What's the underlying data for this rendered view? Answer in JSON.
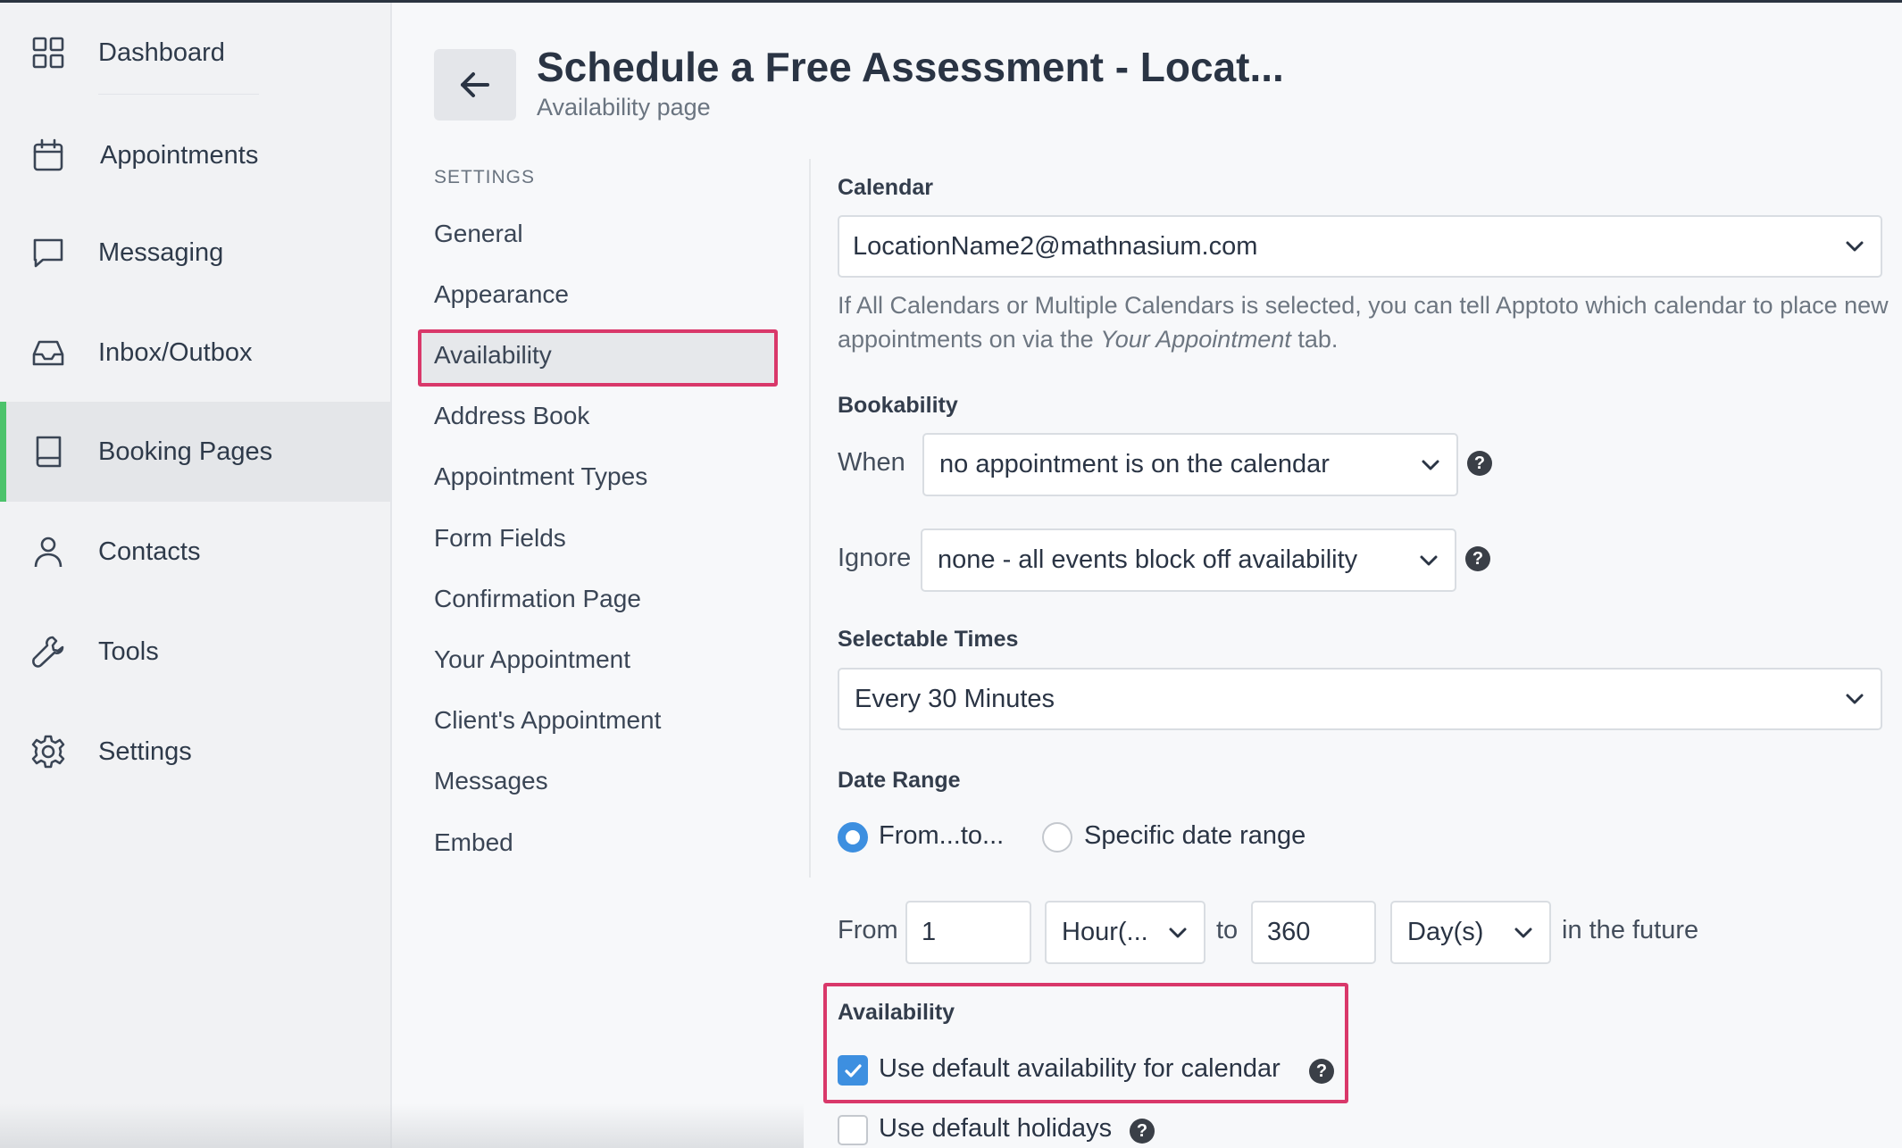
{
  "sidebar": {
    "items": [
      {
        "label": "Dashboard",
        "icon": "grid-icon"
      },
      {
        "label": "Appointments",
        "icon": "calendar-icon"
      },
      {
        "label": "Messaging",
        "icon": "chat-bubble-icon"
      },
      {
        "label": "Inbox/Outbox",
        "icon": "inbox-icon"
      },
      {
        "label": "Booking Pages",
        "icon": "book-icon",
        "active": true
      },
      {
        "label": "Contacts",
        "icon": "user-icon"
      },
      {
        "label": "Tools",
        "icon": "wrench-icon"
      },
      {
        "label": "Settings",
        "icon": "gear-icon"
      }
    ],
    "active_color": "#4cc36b"
  },
  "header": {
    "title": "Schedule a Free Assessment - Locat...",
    "subtitle": "Availability page"
  },
  "settings_nav": {
    "heading": "SETTINGS",
    "items": [
      "General",
      "Appearance",
      "Availability",
      "Address Book",
      "Appointment Types",
      "Form Fields",
      "Confirmation Page",
      "Your Appointment",
      "Client's Appointment",
      "Messages",
      "Embed"
    ],
    "active": "Availability",
    "highlight_color": "#d9386a"
  },
  "form": {
    "calendar": {
      "label": "Calendar",
      "value": "LocationName2@mathnasium.com",
      "help_line1": "If All Calendars or Multiple Calendars is selected, you can tell Apptoto which calendar to place new",
      "help_line2_pre": "appointments on via the ",
      "help_line2_em": "Your Appointment",
      "help_line2_post": " tab."
    },
    "bookability": {
      "label": "Bookability",
      "when_label": "When",
      "when_value": "no appointment is on the calendar",
      "ignore_label": "Ignore",
      "ignore_value": "none - all events block off availability"
    },
    "selectable_times": {
      "label": "Selectable Times",
      "value": "Every 30 Minutes"
    },
    "date_range": {
      "label": "Date Range",
      "option_from_to": "From...to...",
      "option_specific": "Specific date range",
      "selected": "From...to...",
      "from_label": "From",
      "from_value": "1",
      "from_unit": "Hour(...",
      "to_label": "to",
      "to_value": "360",
      "to_unit": "Day(s)",
      "suffix": "in the future"
    },
    "availability": {
      "label": "Availability",
      "use_default_availability": "Use default availability for calendar",
      "use_default_availability_checked": true,
      "use_default_holidays": "Use default holidays",
      "use_default_holidays_checked": false
    }
  },
  "colors": {
    "accent_blue": "#3d8fe0",
    "highlight_pink": "#d9386a"
  }
}
